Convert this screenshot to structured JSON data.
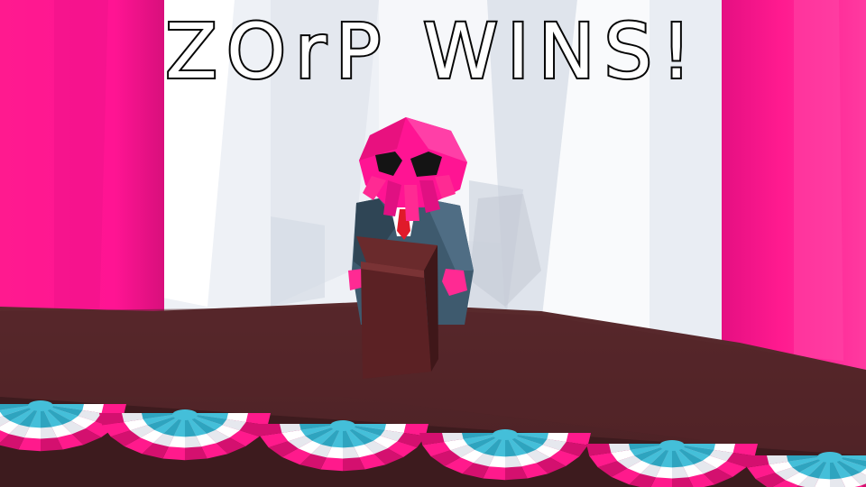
{
  "title": "ZOrP WINS!",
  "colors": {
    "curtain": "#ff1493",
    "curtain_shadow": "#e00e7e",
    "backdrop": "#f4f6fa",
    "stage": "#4e2226",
    "stage_front": "#3d1b1e",
    "podium": "#5b2124",
    "suit": "#3e5a6e",
    "bunting_pink": "#ff1a8c",
    "bunting_blue": "#44bfd9",
    "bunting_white": "#ffffff"
  },
  "icons": [
    "alien-candidate-character",
    "podium",
    "stage-bunting"
  ]
}
